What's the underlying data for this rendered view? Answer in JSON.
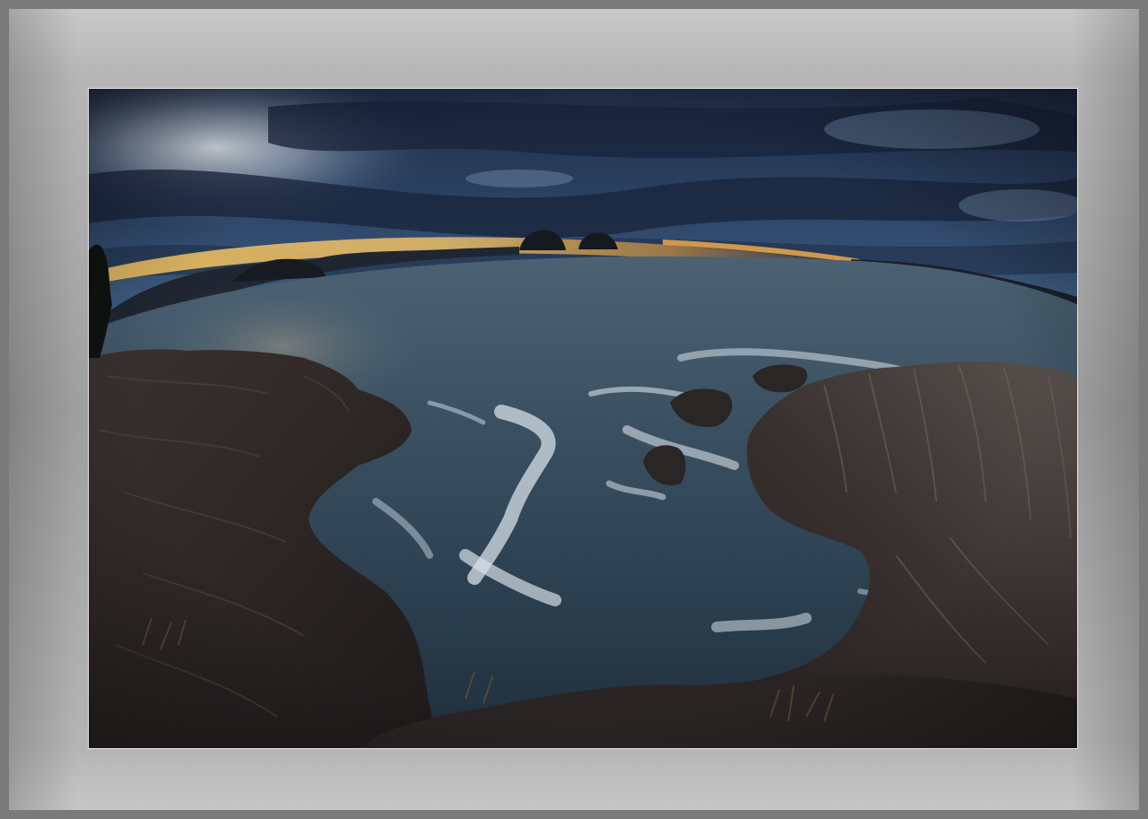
{
  "image": {
    "kind": "framed-photograph",
    "subject": "fisheye-coastline-at-dusk",
    "colors": {
      "frame_outer": "#7a7a7a",
      "frame_mat_light": "#c8c8c8",
      "frame_mat_dark": "#9e9e9e",
      "sky_dark": "#1b2638",
      "sky_blue": "#3d5878",
      "sunset_glow": "#f2b34a",
      "sea": "#3e5566",
      "rock": "#2b2626",
      "foam": "#d8e2ea"
    }
  }
}
